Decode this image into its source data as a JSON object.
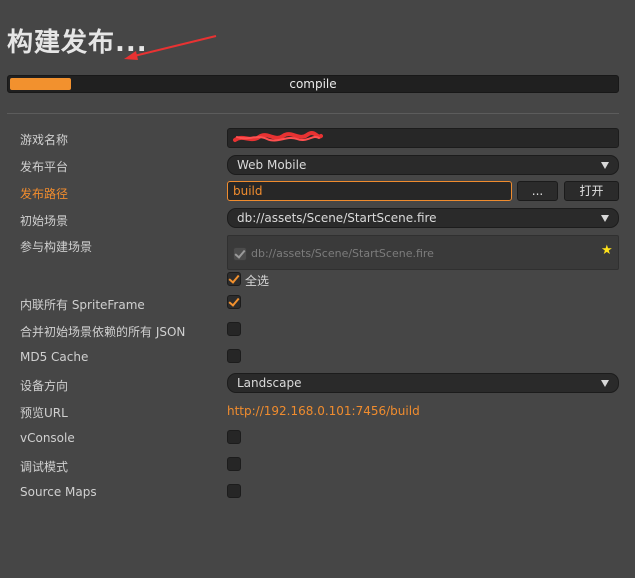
{
  "window": {
    "title": "构建发布..."
  },
  "progress": {
    "label": "compile",
    "value_percent": 10
  },
  "form": {
    "game_name": {
      "label": "游戏名称",
      "value": ""
    },
    "platform": {
      "label": "发布平台",
      "value": "Web Mobile"
    },
    "build_path": {
      "label": "发布路径",
      "value": "build",
      "browse_button": "...",
      "open_button": "打开"
    },
    "start_scene": {
      "label": "初始场景",
      "value": "db://assets/Scene/StartScene.fire"
    },
    "included_scenes": {
      "label": "参与构建场景",
      "items": [
        "db://assets/Scene/StartScene.fire"
      ],
      "select_all": "全选"
    },
    "inline_spriteframe": {
      "label": "内联所有 SpriteFrame",
      "checked": true
    },
    "merge_json": {
      "label": "合并初始场景依赖的所有 JSON",
      "checked": false
    },
    "md5_cache": {
      "label": "MD5 Cache",
      "checked": false
    },
    "orientation": {
      "label": "设备方向",
      "value": "Landscape"
    },
    "preview_url": {
      "label": "预览URL",
      "value": "http://192.168.0.101:7456/build"
    },
    "vconsole": {
      "label": "vConsole",
      "checked": false
    },
    "debug_mode": {
      "label": "调试模式",
      "checked": false
    },
    "source_maps": {
      "label": "Source Maps",
      "checked": false
    }
  },
  "colors": {
    "accent": "#f08c2e",
    "background": "#464646",
    "annotation": "#e83232"
  }
}
